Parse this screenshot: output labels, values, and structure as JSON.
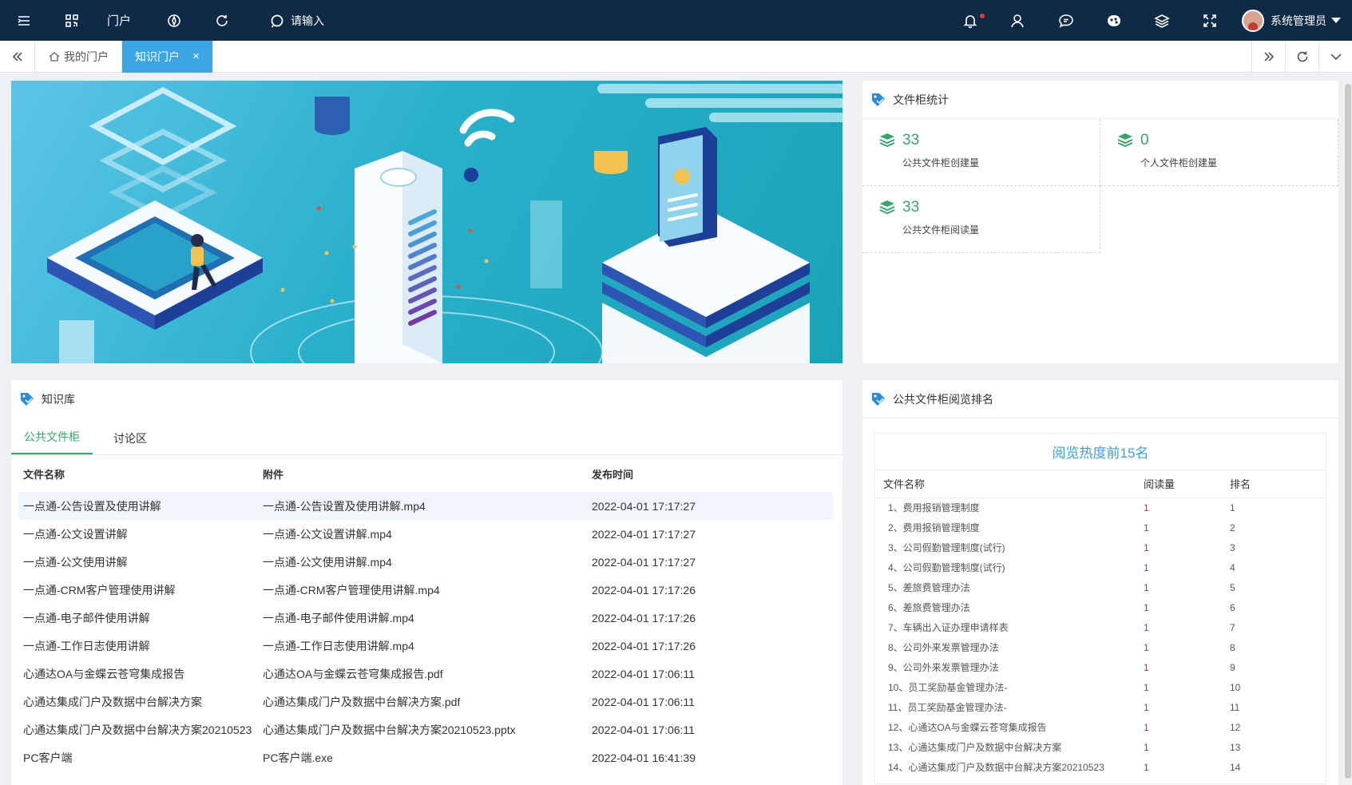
{
  "topbar": {
    "menu_label": "门户",
    "search_placeholder": "请输入",
    "user_name": "系统管理员"
  },
  "tabs": {
    "items": [
      {
        "label": "我的门户"
      },
      {
        "label": "知识门户"
      }
    ],
    "close_glyph": "×"
  },
  "stats": {
    "title": "文件柜统计",
    "cells": [
      {
        "value": "33",
        "label": "公共文件柜创建量"
      },
      {
        "value": "0",
        "label": "个人文件柜创建量"
      },
      {
        "value": "33",
        "label": "公共文件柜阅读量"
      }
    ]
  },
  "kb": {
    "title": "知识库",
    "tabs": [
      "公共文件柜",
      "讨论区"
    ],
    "columns": [
      "文件名称",
      "附件",
      "发布时间"
    ],
    "rows": [
      [
        "一点通-公告设置及使用讲解",
        "一点通-公告设置及使用讲解.mp4",
        "2022-04-01 17:17:27"
      ],
      [
        "一点通-公文设置讲解",
        "一点通-公文设置讲解.mp4",
        "2022-04-01 17:17:27"
      ],
      [
        "一点通-公文使用讲解",
        "一点通-公文使用讲解.mp4",
        "2022-04-01 17:17:27"
      ],
      [
        "一点通-CRM客户管理使用讲解",
        "一点通-CRM客户管理使用讲解.mp4",
        "2022-04-01 17:17:26"
      ],
      [
        "一点通-电子邮件使用讲解",
        "一点通-电子邮件使用讲解.mp4",
        "2022-04-01 17:17:26"
      ],
      [
        "一点通-工作日志使用讲解",
        "一点通-工作日志使用讲解.mp4",
        "2022-04-01 17:17:26"
      ],
      [
        "心通达OA与金蝶云苍穹集成报告",
        "心通达OA与金蝶云苍穹集成报告.pdf",
        "2022-04-01 17:06:11"
      ],
      [
        "心通达集成门户及数据中台解决方案",
        "心通达集成门户及数据中台解决方案.pdf",
        "2022-04-01 17:06:11"
      ],
      [
        "心通达集成门户及数据中台解决方案20210523",
        "心通达集成门户及数据中台解决方案20210523.pptx",
        "2022-04-01 17:06:11"
      ],
      [
        "PC客户端",
        "PC客户端.exe",
        "2022-04-01 16:41:39"
      ]
    ]
  },
  "rank": {
    "title": "公共文件柜阅览排名",
    "heading": "阅览热度前15名",
    "columns": [
      "文件名称",
      "阅读量",
      "排名"
    ],
    "rows": [
      [
        "1、费用报销管理制度",
        "1",
        "1"
      ],
      [
        "2、费用报销管理制度",
        "1",
        "2"
      ],
      [
        "3、公司假勤管理制度(试行)",
        "1",
        "3"
      ],
      [
        "4、公司假勤管理制度(试行)",
        "1",
        "4"
      ],
      [
        "5、差旅费管理办法",
        "1",
        "5"
      ],
      [
        "6、差旅费管理办法",
        "1",
        "6"
      ],
      [
        "7、车辆出入证办理申请样表",
        "1",
        "7"
      ],
      [
        "8、公司外来发票管理办法",
        "1",
        "8"
      ],
      [
        "9、公司外来发票管理办法",
        "1",
        "9"
      ],
      [
        "10、员工奖励基金管理办法-",
        "1",
        "10"
      ],
      [
        "11、员工奖励基金管理办法-",
        "1",
        "11"
      ],
      [
        "12、心通达OA与金蝶云苍穹集成报告",
        "1",
        "12"
      ],
      [
        "13、心通达集成门户及数据中台解决方案",
        "1",
        "13"
      ],
      [
        "14、心通达集成门户及数据中台解决方案20210523",
        "1",
        "14"
      ]
    ]
  },
  "colors": {
    "topbar": "#0f2a47",
    "active_tab": "#3ba6e6",
    "accent_green": "#3aa56a",
    "rank_title": "#3aa0d8",
    "count_red": "#d2293a"
  },
  "icons": [
    "hamburger-icon",
    "qr-grid-icon",
    "compass-icon",
    "refresh-icon",
    "search-icon",
    "bell-icon",
    "user-icon",
    "chat-icon",
    "skin-icon",
    "layers-icon",
    "fullscreen-icon",
    "home-icon",
    "double-left-icon",
    "double-right-icon",
    "chevron-down-icon",
    "tag-icon",
    "stack-icon"
  ]
}
